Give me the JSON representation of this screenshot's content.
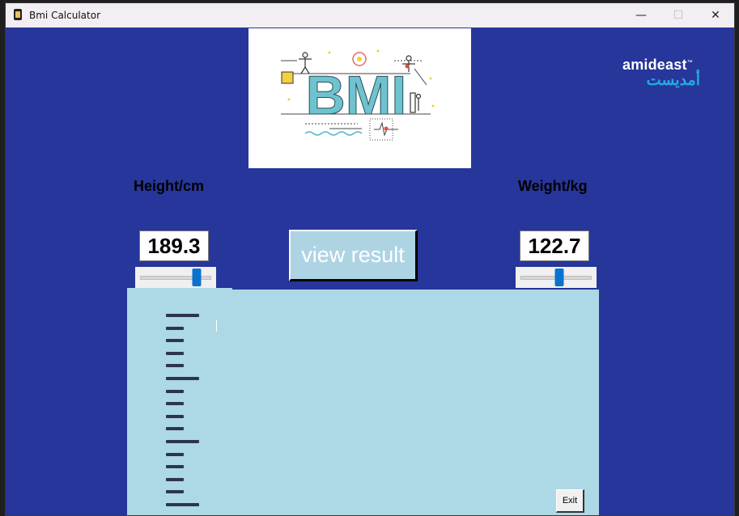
{
  "window": {
    "title": "Bmi Calculator",
    "controls": {
      "minimize": "—",
      "maximize": "☐",
      "close": "✕"
    }
  },
  "colors": {
    "background": "#26369a",
    "result_panel": "#add8e5",
    "button_face": "#aed4e4",
    "slider_thumb": "#0a72cf",
    "amideast_arabic": "#25a9e1"
  },
  "banner": {
    "text": "BMI",
    "icon": "bmi-infographic"
  },
  "logo": {
    "en": "amideast",
    "tm": "™",
    "ar": "أمديست"
  },
  "height": {
    "label": "Height/cm",
    "value": "189.3",
    "slider_fraction": 0.8
  },
  "weight": {
    "label": "Weight/kg",
    "value": "122.7",
    "slider_fraction": 0.55
  },
  "actions": {
    "view_result": "view result",
    "exit": "Exit"
  }
}
